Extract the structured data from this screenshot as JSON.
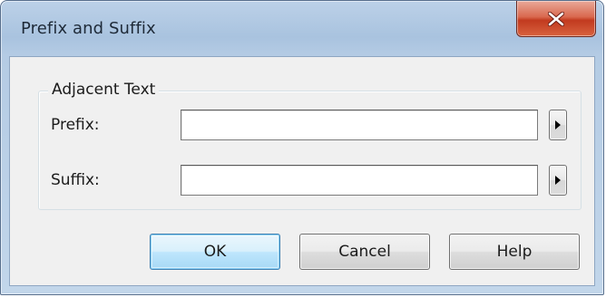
{
  "window": {
    "title": "Prefix and Suffix",
    "close_icon": "close-x-icon"
  },
  "group": {
    "legend": "Adjacent Text"
  },
  "fields": {
    "prefix": {
      "label": "Prefix:",
      "value": "",
      "arrow_icon": "triangle-right-icon"
    },
    "suffix": {
      "label": "Suffix:",
      "value": "",
      "arrow_icon": "triangle-right-icon"
    }
  },
  "buttons": {
    "ok": "OK",
    "cancel": "Cancel",
    "help": "Help"
  },
  "colors": {
    "title_bar": "#a9c3df",
    "close_button": "#c23a1f",
    "dialog_face": "#f0f0f0",
    "default_button": "#bee6fd"
  }
}
